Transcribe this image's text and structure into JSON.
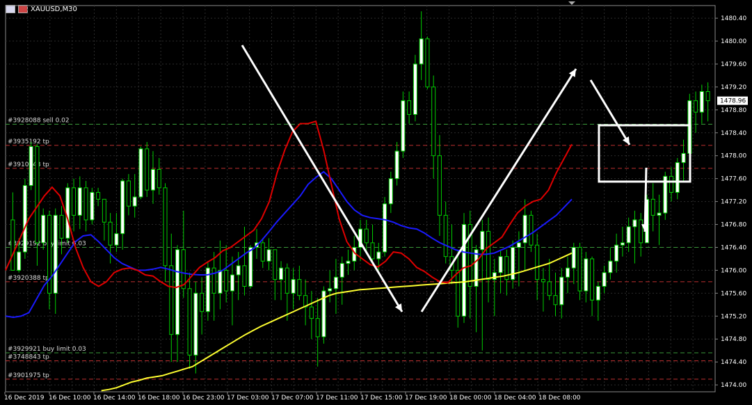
{
  "window": {
    "title": "XAUUSD,M30"
  },
  "price_labels": [
    "1480.40",
    "1480.00",
    "1479.60",
    "1479.20",
    "1478.80",
    "1478.40",
    "1478.00",
    "1477.60",
    "1477.20",
    "1476.80",
    "1476.40",
    "1476.00",
    "1475.60",
    "1475.20",
    "1474.80",
    "1474.40",
    "1474.00"
  ],
  "current_price": "1478.96",
  "time_labels": [
    "16 Dec 2019",
    "16 Dec 10:00",
    "16 Dec 14:00",
    "16 Dec 18:00",
    "16 Dec 23:00",
    "17 Dec 03:00",
    "17 Dec 07:00",
    "17 Dec 11:00",
    "17 Dec 15:00",
    "17 Dec 19:00",
    "18 Dec 00:00",
    "18 Dec 04:00",
    "18 Dec 08:00"
  ],
  "order_lines": [
    {
      "label": "#3928088 sell 0.02",
      "price": 1478.55,
      "color": "#3a9a3a"
    },
    {
      "label": "#3935192 tp",
      "price": 1478.18,
      "color": "#c03030"
    },
    {
      "label": "#3910543 tp",
      "price": 1477.78,
      "color": "#c03030"
    },
    {
      "label": "#3929192 buy limit 0.03",
      "price": 1476.4,
      "color": "#3a9a3a"
    },
    {
      "label": "#3920388 tp",
      "price": 1475.8,
      "color": "#c03030"
    },
    {
      "label": "#3929921 buy limit 0.03",
      "price": 1474.56,
      "color": "#3a9a3a"
    },
    {
      "label": "#3748843 tp",
      "price": 1474.42,
      "color": "#c03030"
    },
    {
      "label": "#3901975 tp",
      "price": 1474.1,
      "color": "#c03030"
    }
  ],
  "chart_data": {
    "type": "candlestick",
    "symbol": "XAUUSD",
    "timeframe": "M30",
    "ylim": [
      1473.88,
      1480.62
    ],
    "y_ticks": [
      1474.0,
      1474.4,
      1474.8,
      1475.2,
      1475.6,
      1476.0,
      1476.4,
      1476.8,
      1477.2,
      1477.6,
      1478.0,
      1478.4,
      1478.8,
      1479.2,
      1479.6,
      1480.0,
      1480.4
    ],
    "grid": true,
    "colors": {
      "background": "#000000",
      "grid": "#2c2c2c",
      "bull": "#ffffff",
      "bear": "#000000",
      "wick": "#00d000",
      "ma_fast": "#e00000",
      "ma_mid": "#1a1aff",
      "ma_slow": "#ffff30",
      "text": "#ffffff"
    },
    "candles": [
      [
        1476.88,
        1477.36,
        1476.0,
        1476.0
      ],
      [
        1476.0,
        1476.56,
        1475.96,
        1476.32
      ],
      [
        1476.32,
        1477.6,
        1476.2,
        1477.48
      ],
      [
        1477.48,
        1478.24,
        1477.4,
        1478.16
      ],
      [
        1478.16,
        1478.2,
        1476.08,
        1476.48
      ],
      [
        1476.48,
        1477.08,
        1476.36,
        1476.96
      ],
      [
        1476.96,
        1477.04,
        1475.32,
        1475.6
      ],
      [
        1475.6,
        1477.08,
        1475.24,
        1476.96
      ],
      [
        1476.96,
        1477.12,
        1476.28,
        1476.56
      ],
      [
        1476.56,
        1477.52,
        1476.48,
        1477.44
      ],
      [
        1477.44,
        1477.6,
        1476.68,
        1476.96
      ],
      [
        1476.96,
        1477.64,
        1476.72,
        1477.44
      ],
      [
        1477.44,
        1477.56,
        1476.68,
        1476.88
      ],
      [
        1476.88,
        1477.44,
        1476.8,
        1477.36
      ],
      [
        1477.36,
        1477.44,
        1477.12,
        1477.24
      ],
      [
        1477.24,
        1477.24,
        1476.52,
        1476.84
      ],
      [
        1476.84,
        1477.0,
        1476.12,
        1476.44
      ],
      [
        1476.44,
        1477.0,
        1476.32,
        1476.64
      ],
      [
        1476.64,
        1477.6,
        1476.36,
        1477.56
      ],
      [
        1477.56,
        1477.68,
        1476.96,
        1477.12
      ],
      [
        1477.12,
        1477.68,
        1476.92,
        1477.28
      ],
      [
        1477.28,
        1478.16,
        1477.24,
        1478.12
      ],
      [
        1478.12,
        1478.24,
        1477.28,
        1477.4
      ],
      [
        1477.4,
        1478.08,
        1477.16,
        1477.76
      ],
      [
        1477.76,
        1477.96,
        1477.32,
        1477.44
      ],
      [
        1477.44,
        1477.52,
        1475.8,
        1476.08
      ],
      [
        1476.08,
        1476.64,
        1474.4,
        1474.88
      ],
      [
        1474.88,
        1476.44,
        1474.4,
        1476.36
      ],
      [
        1476.36,
        1477.04,
        1475.52,
        1475.68
      ],
      [
        1475.68,
        1475.96,
        1474.28,
        1474.52
      ],
      [
        1474.52,
        1475.8,
        1474.2,
        1475.6
      ],
      [
        1475.6,
        1475.88,
        1474.88,
        1475.28
      ],
      [
        1475.28,
        1476.16,
        1475.12,
        1476.04
      ],
      [
        1476.04,
        1476.32,
        1475.12,
        1475.6
      ],
      [
        1475.6,
        1476.52,
        1475.32,
        1476.0
      ],
      [
        1476.0,
        1476.44,
        1475.44,
        1475.64
      ],
      [
        1475.64,
        1476.24,
        1475.04,
        1475.92
      ],
      [
        1475.92,
        1476.32,
        1475.48,
        1476.08
      ],
      [
        1476.08,
        1476.76,
        1475.56,
        1475.72
      ],
      [
        1475.72,
        1476.44,
        1475.68,
        1476.4
      ],
      [
        1476.4,
        1476.72,
        1476.2,
        1476.48
      ],
      [
        1476.48,
        1476.56,
        1476.04,
        1476.16
      ],
      [
        1476.16,
        1476.56,
        1476.0,
        1476.36
      ],
      [
        1476.36,
        1476.36,
        1475.48,
        1475.84
      ],
      [
        1475.84,
        1476.16,
        1475.48,
        1476.04
      ],
      [
        1476.04,
        1476.12,
        1475.12,
        1475.6
      ],
      [
        1475.6,
        1476.04,
        1475.32,
        1475.84
      ],
      [
        1475.84,
        1476.08,
        1475.48,
        1475.56
      ],
      [
        1475.56,
        1475.84,
        1475.04,
        1475.36
      ],
      [
        1475.36,
        1475.64,
        1474.8,
        1475.16
      ],
      [
        1475.16,
        1475.52,
        1474.32,
        1474.84
      ],
      [
        1474.84,
        1475.72,
        1474.72,
        1475.64
      ],
      [
        1475.64,
        1476.0,
        1475.44,
        1475.68
      ],
      [
        1475.68,
        1476.2,
        1475.24,
        1475.88
      ],
      [
        1475.88,
        1476.24,
        1475.4,
        1476.12
      ],
      [
        1476.12,
        1476.36,
        1475.92,
        1476.16
      ],
      [
        1476.16,
        1476.6,
        1476.0,
        1476.4
      ],
      [
        1476.4,
        1476.88,
        1476.16,
        1476.72
      ],
      [
        1476.72,
        1476.88,
        1476.32,
        1476.48
      ],
      [
        1476.48,
        1476.8,
        1476.16,
        1476.2
      ],
      [
        1476.2,
        1476.48,
        1476.0,
        1476.32
      ],
      [
        1476.32,
        1477.28,
        1476.24,
        1477.16
      ],
      [
        1477.16,
        1477.72,
        1477.0,
        1477.6
      ],
      [
        1477.6,
        1478.24,
        1477.48,
        1478.08
      ],
      [
        1478.08,
        1479.12,
        1477.96,
        1478.96
      ],
      [
        1478.96,
        1479.12,
        1478.56,
        1478.72
      ],
      [
        1478.72,
        1479.76,
        1478.6,
        1479.6
      ],
      [
        1479.6,
        1480.52,
        1479.32,
        1480.04
      ],
      [
        1480.04,
        1480.08,
        1479.16,
        1479.2
      ],
      [
        1479.2,
        1479.4,
        1477.6,
        1478.0
      ],
      [
        1478.0,
        1478.36,
        1476.6,
        1476.96
      ],
      [
        1476.96,
        1477.2,
        1476.12,
        1476.24
      ],
      [
        1476.24,
        1476.8,
        1475.76,
        1476.0
      ],
      [
        1476.0,
        1476.36,
        1475.0,
        1475.2
      ],
      [
        1475.2,
        1477.0,
        1475.08,
        1476.8
      ],
      [
        1476.8,
        1477.04,
        1475.16,
        1475.72
      ],
      [
        1475.72,
        1476.44,
        1474.92,
        1476.36
      ],
      [
        1476.36,
        1476.88,
        1474.6,
        1476.68
      ],
      [
        1476.68,
        1476.92,
        1475.44,
        1475.84
      ],
      [
        1475.84,
        1476.2,
        1475.2,
        1475.96
      ],
      [
        1475.96,
        1476.36,
        1475.6,
        1476.24
      ],
      [
        1476.24,
        1476.36,
        1475.56,
        1475.84
      ],
      [
        1475.84,
        1476.52,
        1475.68,
        1476.4
      ],
      [
        1476.4,
        1476.68,
        1475.72,
        1476.48
      ],
      [
        1476.48,
        1477.24,
        1476.0,
        1476.96
      ],
      [
        1476.96,
        1477.04,
        1476.32,
        1476.44
      ],
      [
        1476.44,
        1476.64,
        1475.48,
        1475.84
      ],
      [
        1475.84,
        1476.04,
        1475.28,
        1475.8
      ],
      [
        1475.8,
        1476.2,
        1475.48,
        1475.56
      ],
      [
        1475.56,
        1475.96,
        1475.2,
        1475.4
      ],
      [
        1475.4,
        1476.04,
        1475.16,
        1475.88
      ],
      [
        1475.88,
        1476.24,
        1475.6,
        1476.04
      ],
      [
        1476.04,
        1476.48,
        1475.76,
        1476.4
      ],
      [
        1476.4,
        1476.48,
        1475.48,
        1475.64
      ],
      [
        1475.64,
        1476.32,
        1475.44,
        1476.2
      ],
      [
        1476.2,
        1476.24,
        1475.2,
        1475.48
      ],
      [
        1475.48,
        1475.8,
        1475.12,
        1475.72
      ],
      [
        1475.72,
        1476.08,
        1475.6,
        1475.96
      ],
      [
        1475.96,
        1476.4,
        1475.84,
        1476.16
      ],
      [
        1476.16,
        1476.64,
        1475.96,
        1476.44
      ],
      [
        1476.44,
        1476.76,
        1476.24,
        1476.48
      ],
      [
        1476.48,
        1476.92,
        1476.32,
        1476.76
      ],
      [
        1476.76,
        1477.04,
        1476.12,
        1476.88
      ],
      [
        1476.88,
        1477.0,
        1476.24,
        1476.48
      ],
      [
        1476.48,
        1477.32,
        1476.48,
        1477.24
      ],
      [
        1477.24,
        1477.52,
        1476.68,
        1476.96
      ],
      [
        1476.96,
        1477.32,
        1476.44,
        1477.0
      ],
      [
        1477.0,
        1477.72,
        1476.88,
        1477.64
      ],
      [
        1477.64,
        1477.8,
        1477.2,
        1477.36
      ],
      [
        1477.36,
        1477.96,
        1477.24,
        1477.88
      ],
      [
        1477.88,
        1478.28,
        1477.56,
        1478.04
      ],
      [
        1478.04,
        1479.08,
        1477.96,
        1478.96
      ],
      [
        1478.96,
        1479.12,
        1478.4,
        1478.76
      ],
      [
        1478.76,
        1479.24,
        1478.56,
        1479.12
      ],
      [
        1479.12,
        1479.28,
        1478.6,
        1478.96
      ]
    ],
    "ma_fast": [
      1476.0,
      1476.3,
      1476.6,
      1476.9,
      1477.1,
      1477.3,
      1477.45,
      1477.3,
      1476.9,
      1476.4,
      1476.05,
      1475.8,
      1475.72,
      1475.8,
      1475.96,
      1476.02,
      1476.04,
      1476.0,
      1475.92,
      1475.9,
      1475.8,
      1475.72,
      1475.7,
      1475.75,
      1475.9,
      1476.05,
      1476.14,
      1476.22,
      1476.34,
      1476.4,
      1476.5,
      1476.6,
      1476.7,
      1476.9,
      1477.2,
      1477.7,
      1478.1,
      1478.42,
      1478.56,
      1478.56,
      1478.6,
      1478.1,
      1477.5,
      1476.9,
      1476.5,
      1476.3,
      1476.2,
      1476.1,
      1476.06,
      1476.16,
      1476.32,
      1476.3,
      1476.2,
      1476.05,
      1475.98,
      1475.88,
      1475.8,
      1475.78,
      1475.92,
      1476.04,
      1476.08,
      1476.2,
      1476.38,
      1476.48,
      1476.58,
      1476.8,
      1477.0,
      1477.12,
      1477.2,
      1477.24,
      1477.4,
      1477.7,
      1477.95,
      1478.2
    ],
    "ma_mid": [
      1475.2,
      1475.18,
      1475.2,
      1475.26,
      1475.5,
      1475.74,
      1475.9,
      1476.1,
      1476.3,
      1476.5,
      1476.6,
      1476.62,
      1476.5,
      1476.36,
      1476.22,
      1476.12,
      1476.06,
      1476.0,
      1476.0,
      1476.02,
      1476.05,
      1476.02,
      1475.98,
      1475.95,
      1475.93,
      1475.92,
      1475.92,
      1475.95,
      1476.0,
      1476.1,
      1476.2,
      1476.3,
      1476.38,
      1476.52,
      1476.68,
      1476.85,
      1477.0,
      1477.15,
      1477.3,
      1477.5,
      1477.62,
      1477.72,
      1477.6,
      1477.4,
      1477.2,
      1477.05,
      1476.96,
      1476.92,
      1476.9,
      1476.88,
      1476.84,
      1476.78,
      1476.74,
      1476.72,
      1476.65,
      1476.56,
      1476.48,
      1476.42,
      1476.36,
      1476.32,
      1476.3,
      1476.28,
      1476.28,
      1476.3,
      1476.36,
      1476.42,
      1476.5,
      1476.58,
      1476.66,
      1476.76,
      1476.86,
      1476.96,
      1477.1,
      1477.24
    ],
    "ma_slow": [
      1473.9,
      1473.92,
      1473.95,
      1474.0,
      1474.05,
      1474.08,
      1474.12,
      1474.14,
      1474.16,
      1474.2,
      1474.24,
      1474.28,
      1474.32,
      1474.4,
      1474.48,
      1474.56,
      1474.64,
      1474.72,
      1474.8,
      1474.88,
      1474.95,
      1475.02,
      1475.08,
      1475.14,
      1475.2,
      1475.26,
      1475.32,
      1475.38,
      1475.44,
      1475.5,
      1475.56,
      1475.6,
      1475.62,
      1475.64,
      1475.66,
      1475.67,
      1475.68,
      1475.69,
      1475.7,
      1475.71,
      1475.72,
      1475.73,
      1475.74,
      1475.75,
      1475.76,
      1475.77,
      1475.78,
      1475.79,
      1475.8,
      1475.82,
      1475.84,
      1475.86,
      1475.88,
      1475.9,
      1475.93,
      1475.96,
      1476.0,
      1476.04,
      1476.08,
      1476.12,
      1476.18,
      1476.24,
      1476.3
    ]
  }
}
